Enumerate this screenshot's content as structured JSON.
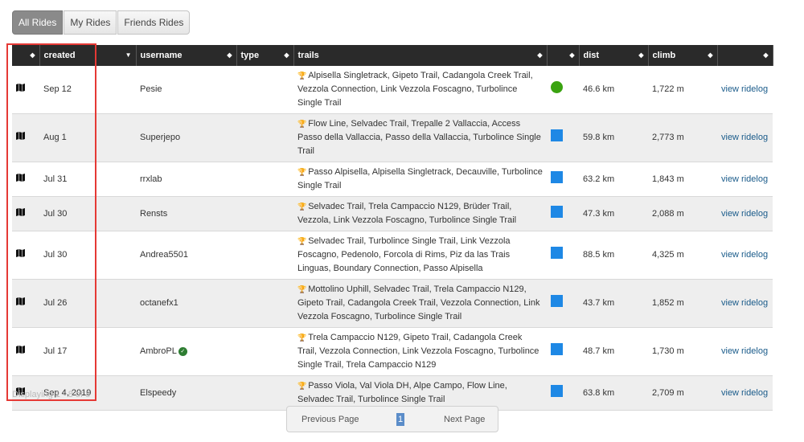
{
  "tabs": [
    {
      "label": "All Rides",
      "active": true
    },
    {
      "label": "My Rides",
      "active": false
    },
    {
      "label": "Friends Rides",
      "active": false
    }
  ],
  "columns": [
    "",
    "created",
    "username",
    "type",
    "trails",
    "",
    "dist",
    "climb",
    ""
  ],
  "rows": [
    {
      "created": "Sep 12",
      "username": "Pesie",
      "verified": false,
      "trails": "Alpisella Singletrack, Gipeto Trail, Cadangola Creek Trail, Vezzola Connection, Link Vezzola Foscagno, Turbolince Single Trail",
      "indicator": "circle",
      "indicator_color": "#3aa310",
      "dist": "46.6 km",
      "climb": "1,722 m",
      "action": "view ridelog"
    },
    {
      "created": "Aug 1",
      "username": "Superjepo",
      "verified": false,
      "trails": "Flow Line, Selvadec Trail, Trepalle 2 Vallaccia, Access Passo della Vallaccia, Passo della Vallaccia, Turbolince Single Trail",
      "indicator": "square",
      "indicator_color": "#1e88e5",
      "dist": "59.8 km",
      "climb": "2,773 m",
      "action": "view ridelog"
    },
    {
      "created": "Jul 31",
      "username": "rrxlab",
      "verified": false,
      "trails": "Passo Alpisella, Alpisella Singletrack, Decauville, Turbolince Single Trail",
      "indicator": "square",
      "indicator_color": "#1e88e5",
      "dist": "63.2 km",
      "climb": "1,843 m",
      "action": "view ridelog"
    },
    {
      "created": "Jul 30",
      "username": "Rensts",
      "verified": false,
      "trails": "Selvadec Trail, Trela Campaccio N129, Brüder Trail, Vezzola, Link Vezzola Foscagno, Turbolince Single Trail",
      "indicator": "square",
      "indicator_color": "#1e88e5",
      "dist": "47.3 km",
      "climb": "2,088 m",
      "action": "view ridelog"
    },
    {
      "created": "Jul 30",
      "username": "Andrea5501",
      "verified": false,
      "trails": "Selvadec Trail, Turbolince Single Trail, Link Vezzola Foscagno, Pedenolo, Forcola di Rims, Piz da las Trais Linguas, Boundary Connection, Passo Alpisella",
      "indicator": "square",
      "indicator_color": "#1e88e5",
      "dist": "88.5 km",
      "climb": "4,325 m",
      "action": "view ridelog"
    },
    {
      "created": "Jul 26",
      "username": "octanefx1",
      "verified": false,
      "trails": "Mottolino Uphill, Selvadec Trail, Trela Campaccio N129, Gipeto Trail, Cadangola Creek Trail, Vezzola Connection, Link Vezzola Foscagno, Turbolince Single Trail",
      "indicator": "square",
      "indicator_color": "#1e88e5",
      "dist": "43.7 km",
      "climb": "1,852 m",
      "action": "view ridelog"
    },
    {
      "created": "Jul 17",
      "username": "AmbroPL",
      "verified": true,
      "trails": "Trela Campaccio N129, Gipeto Trail, Cadangola Creek Trail, Vezzola Connection, Link Vezzola Foscagno, Turbolince Single Trail, Trela Campaccio N129",
      "indicator": "square",
      "indicator_color": "#1e88e5",
      "dist": "48.7 km",
      "climb": "1,730 m",
      "action": "view ridelog"
    },
    {
      "created": "Sep 4, 2019",
      "username": "Elspeedy",
      "verified": false,
      "trails": "Passo Viola, Val Viola DH, Alpe Campo, Flow Line, Selvadec Trail, Turbolince Single Trail",
      "indicator": "square",
      "indicator_color": "#1e88e5",
      "dist": "63.8 km",
      "climb": "2,709 m",
      "action": "view ridelog"
    }
  ],
  "footer": {
    "displaying": "Displaying 1 - 8 of 8"
  },
  "pager": {
    "prev": "Previous Page",
    "current": "1",
    "next": "Next Page"
  }
}
